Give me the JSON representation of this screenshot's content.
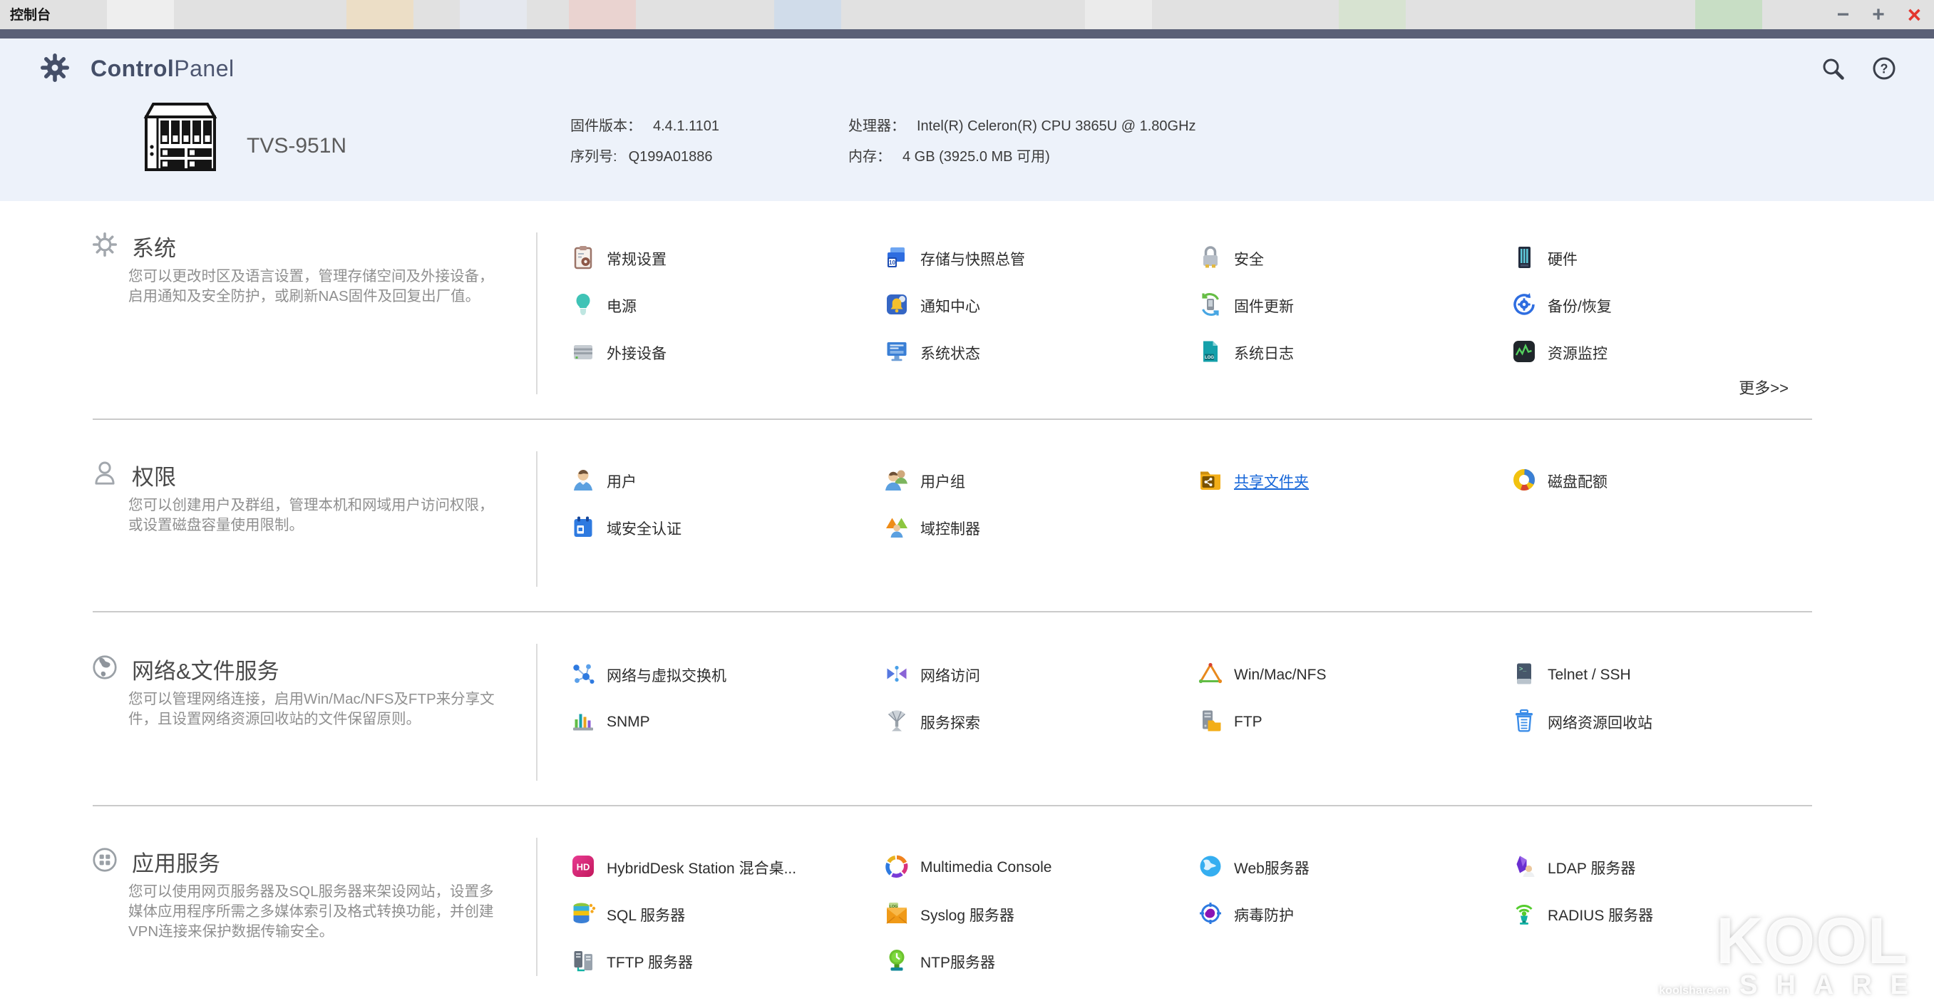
{
  "window": {
    "title": "控制台",
    "minimize_label": "−",
    "maximize_label": "+",
    "close_label": "×"
  },
  "app_header": {
    "gear_icon": "controlpanel-gear-icon",
    "brand_bold": "Control",
    "brand_light": "Panel",
    "search_icon": "search-icon",
    "help_icon": "help-icon"
  },
  "device": {
    "model": "TVS-951N",
    "info": [
      {
        "label": "固件版本：",
        "value": "4.4.1.1101"
      },
      {
        "label": "处理器：",
        "value": "Intel(R) Celeron(R) CPU 3865U @ 1.80GHz"
      },
      {
        "label": "序列号:",
        "value": "Q199A01886"
      },
      {
        "label": "内存：",
        "value": "4 GB (3925.0 MB 可用)"
      }
    ]
  },
  "sections": [
    {
      "id": "system",
      "icon": "system-section-icon",
      "title": "系统",
      "description": "您可以更改时区及语言设置，管理存储空间及外接设备，启用通知及安全防护，或刷新NAS固件及回复出厂值。",
      "more_link": "更多>>",
      "items": [
        {
          "label": "常规设置",
          "icon": "general-settings-icon"
        },
        {
          "label": "存储与快照总管",
          "icon": "storage-snapshot-icon"
        },
        {
          "label": "安全",
          "icon": "security-icon"
        },
        {
          "label": "硬件",
          "icon": "hardware-icon"
        },
        {
          "label": "电源",
          "icon": "power-icon"
        },
        {
          "label": "通知中心",
          "icon": "notification-center-icon"
        },
        {
          "label": "固件更新",
          "icon": "firmware-update-icon"
        },
        {
          "label": "备份/恢复",
          "icon": "backup-restore-icon"
        },
        {
          "label": "外接设备",
          "icon": "external-device-icon"
        },
        {
          "label": "系统状态",
          "icon": "system-status-icon"
        },
        {
          "label": "系统日志",
          "icon": "system-logs-icon"
        },
        {
          "label": "资源监控",
          "icon": "resource-monitor-icon"
        }
      ]
    },
    {
      "id": "privilege",
      "icon": "privilege-section-icon",
      "title": "权限",
      "description": "您可以创建用户及群组，管理本机和网域用户访问权限，或设置磁盘容量使用限制。",
      "items": [
        {
          "label": "用户",
          "icon": "user-icon"
        },
        {
          "label": "用户组",
          "icon": "user-group-icon"
        },
        {
          "label": "共享文件夹",
          "icon": "shared-folder-icon",
          "link": true
        },
        {
          "label": "磁盘配额",
          "icon": "quota-icon"
        },
        {
          "label": "域安全认证",
          "icon": "domain-security-icon"
        },
        {
          "label": "域控制器",
          "icon": "domain-controller-icon"
        }
      ]
    },
    {
      "id": "network-file-services",
      "icon": "network-section-icon",
      "title": "网络&文件服务",
      "description": "您可以管理网络连接，启用Win/Mac/NFS及FTP来分享文件，且设置网络资源回收站的文件保留原则。",
      "items": [
        {
          "label": "网络与虚拟交换机",
          "icon": "virtual-switch-icon"
        },
        {
          "label": "网络访问",
          "icon": "network-access-icon"
        },
        {
          "label": "Win/Mac/NFS",
          "icon": "win-mac-nfs-icon"
        },
        {
          "label": "Telnet / SSH",
          "icon": "telnet-ssh-icon"
        },
        {
          "label": "SNMP",
          "icon": "snmp-icon"
        },
        {
          "label": "服务探索",
          "icon": "service-discovery-icon"
        },
        {
          "label": "FTP",
          "icon": "ftp-icon"
        },
        {
          "label": "网络资源回收站",
          "icon": "network-recycle-bin-icon"
        }
      ]
    },
    {
      "id": "applications",
      "icon": "apps-section-icon",
      "title": "应用服务",
      "description": "您可以使用网页服务器及SQL服务器来架设网站，设置多媒体应用程序所需之多媒体索引及格式转换功能，并创建VPN连接来保护数据传输安全。",
      "items": [
        {
          "label": "HybridDesk Station 混合桌...",
          "icon": "hybriddesk-icon"
        },
        {
          "label": "Multimedia Console",
          "icon": "multimedia-console-icon"
        },
        {
          "label": "Web服务器",
          "icon": "web-server-icon"
        },
        {
          "label": "LDAP 服务器",
          "icon": "ldap-server-icon"
        },
        {
          "label": "SQL 服务器",
          "icon": "sql-server-icon"
        },
        {
          "label": "Syslog 服务器",
          "icon": "syslog-server-icon"
        },
        {
          "label": "病毒防护",
          "icon": "antivirus-icon"
        },
        {
          "label": "RADIUS 服务器",
          "icon": "radius-server-icon"
        },
        {
          "label": "TFTP 服务器",
          "icon": "tftp-server-icon"
        },
        {
          "label": "NTP服务器",
          "icon": "ntp-server-icon"
        }
      ]
    }
  ],
  "watermark": {
    "line1": "KOOL",
    "line2": "SHARE",
    "site": "koolshare.cn"
  },
  "colors": {
    "link_accent": "#1465d8",
    "titlebar_dark": "#5a6076",
    "panel_background": "#edf2fa",
    "close_button": "#e3372f"
  }
}
